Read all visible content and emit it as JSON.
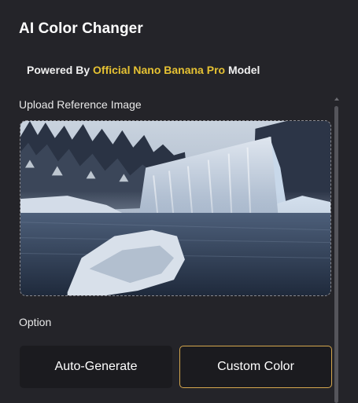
{
  "header": {
    "title": "AI Color Changer"
  },
  "powered": {
    "prefix": "Powered By",
    "highlight": "Official Nano Banana Pro",
    "suffix": "Model"
  },
  "upload": {
    "label": "Upload Reference Image",
    "image_subject": "frozen-waterfall-landscape"
  },
  "option": {
    "label": "Option",
    "buttons": [
      {
        "label": "Auto-Generate",
        "selected": false
      },
      {
        "label": "Custom Color",
        "selected": true
      }
    ]
  },
  "colors": {
    "accent": "#e6c233",
    "selected_border": "#d5a74d",
    "background": "#242429"
  }
}
